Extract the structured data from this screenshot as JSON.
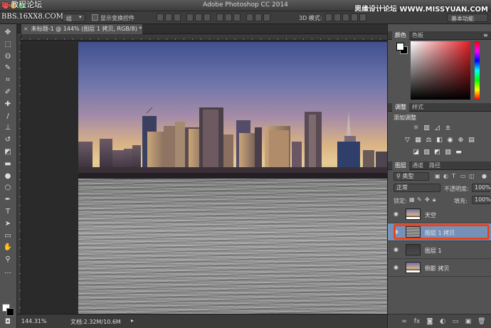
{
  "app": {
    "window_title": "Adobe Photoshop CC 2014",
    "workspace": "基本功能"
  },
  "watermarks": {
    "top_left_ps": "PS",
    "top_left_text": "教程论坛",
    "bbs_text": "BBS.16XX8.COM",
    "top_right": "思缘设计论坛 WWW.MISSYUAN.COM"
  },
  "options_bar": {
    "dropdown_value": "组",
    "show_transform_label": "显示变换控件",
    "mode_3d_label": "3D 模式:"
  },
  "document_tab": {
    "label": "未标题-1 @ 144% (图层 1 拷贝, RGB/8) *"
  },
  "tools": [
    {
      "name": "move-tool",
      "icon": "✥"
    },
    {
      "name": "marquee-tool",
      "icon": "⬚"
    },
    {
      "name": "lasso-tool",
      "icon": "ʘ"
    },
    {
      "name": "quick-select-tool",
      "icon": "✎"
    },
    {
      "name": "crop-tool",
      "icon": "⌗"
    },
    {
      "name": "eyedropper-tool",
      "icon": "✐"
    },
    {
      "name": "healing-tool",
      "icon": "✚"
    },
    {
      "name": "brush-tool",
      "icon": "/"
    },
    {
      "name": "stamp-tool",
      "icon": "⊥"
    },
    {
      "name": "history-brush-tool",
      "icon": "↺"
    },
    {
      "name": "eraser-tool",
      "icon": "◩"
    },
    {
      "name": "gradient-tool",
      "icon": "▬"
    },
    {
      "name": "blur-tool",
      "icon": "●"
    },
    {
      "name": "dodge-tool",
      "icon": "○"
    },
    {
      "name": "pen-tool",
      "icon": "✒"
    },
    {
      "name": "type-tool",
      "icon": "T"
    },
    {
      "name": "path-select-tool",
      "icon": "➤"
    },
    {
      "name": "shape-tool",
      "icon": "▭"
    },
    {
      "name": "hand-tool",
      "icon": "✋"
    },
    {
      "name": "zoom-tool",
      "icon": "⚲"
    },
    {
      "name": "more-tools",
      "icon": "…"
    }
  ],
  "status_bar": {
    "zoom": "144.31%",
    "doc_size": "文档:2.32M/10.6M"
  },
  "color_panel": {
    "tabs": [
      "颜色",
      "色板"
    ],
    "foreground": "#ffffff",
    "background": "#000000",
    "hue": "#e01e25"
  },
  "adjustments_panel": {
    "tabs": [
      "调整",
      "样式"
    ],
    "heading": "添加调整",
    "icons": [
      [
        "brightness-icon",
        "levels-icon",
        "curves-icon",
        "exposure-icon"
      ],
      [
        "vibrance-icon",
        "hue-saturation-icon",
        "color-balance-icon",
        "black-white-icon",
        "photo-filter-icon",
        "channel-mixer-icon",
        "color-lookup-icon"
      ],
      [
        "invert-icon",
        "posterize-icon",
        "threshold-icon",
        "selective-color-icon",
        "gradient-map-icon"
      ]
    ]
  },
  "layers_panel": {
    "tabs": [
      "图层",
      "通道",
      "路径"
    ],
    "filter_kind": "类型",
    "blend_mode": "正常",
    "opacity_label": "不透明度:",
    "opacity_value": "100%",
    "lock_label": "锁定:",
    "fill_label": "填充:",
    "fill_value": "100%",
    "layers": [
      {
        "name": "天空",
        "selected": false,
        "thumb": "sky"
      },
      {
        "name": "图层 1 拷贝",
        "selected": true,
        "thumb": "water"
      },
      {
        "name": "图层 1",
        "selected": false,
        "thumb": "dark"
      },
      {
        "name": "倒影 拷贝",
        "selected": false,
        "thumb": "sky"
      }
    ]
  },
  "colors": {
    "highlight": "#e8431f",
    "selected_layer": "#7591b7",
    "panel_bg": "#535353"
  }
}
